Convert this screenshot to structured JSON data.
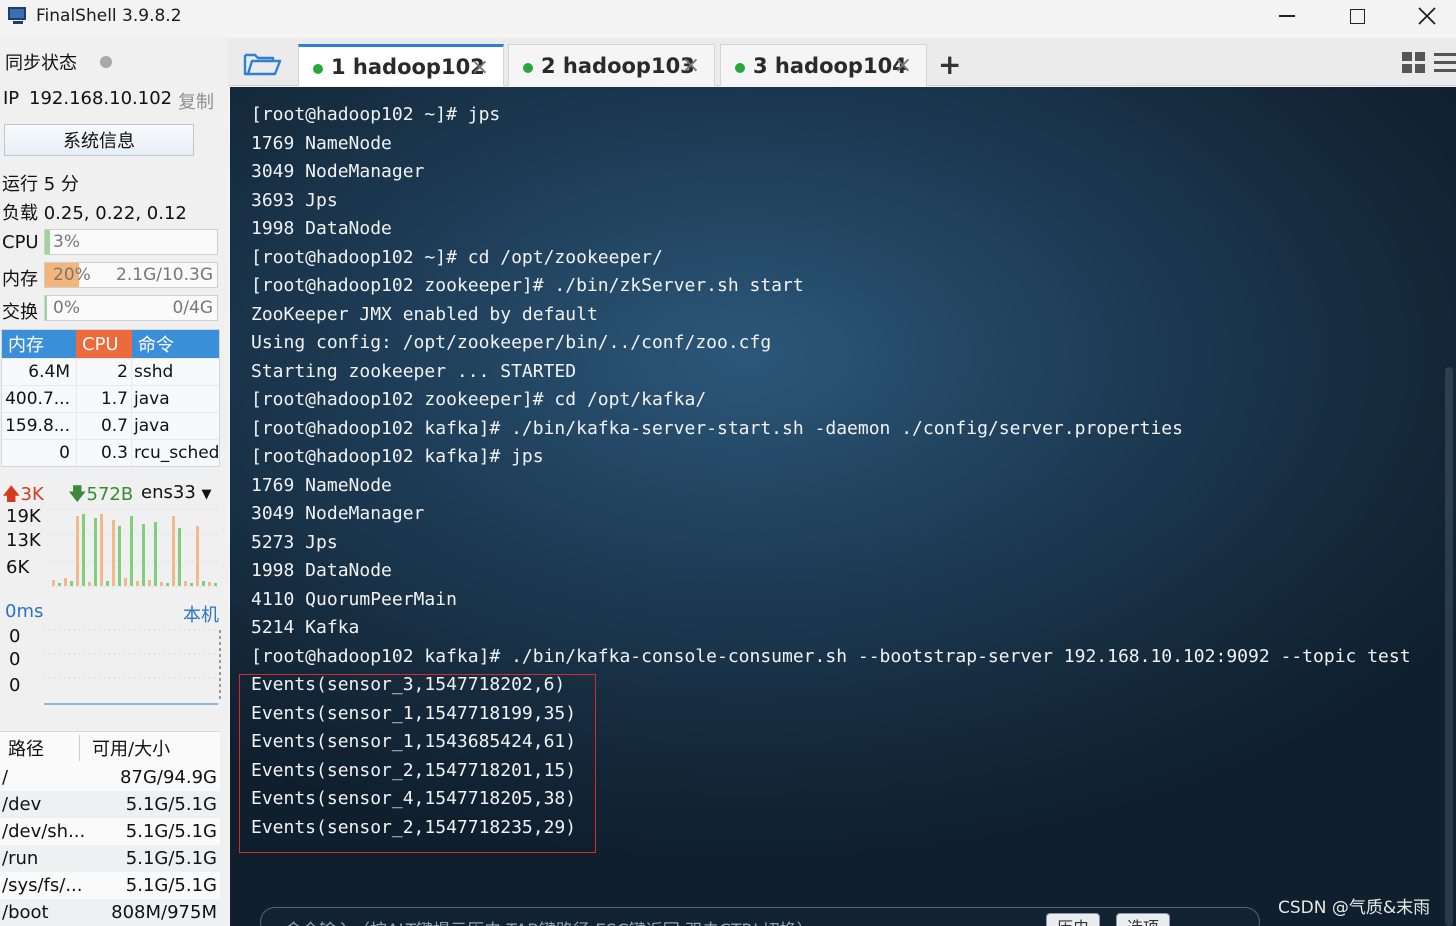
{
  "window": {
    "title": "FinalShell 3.9.8.2"
  },
  "sidebar": {
    "sync_label": "同步状态",
    "ip_label": "IP",
    "ip_value": "192.168.10.102",
    "copy_label": "复制",
    "sysinfo_button": "系统信息",
    "uptime": "运行 5 分",
    "load": "负载 0.25, 0.22, 0.12",
    "cpu": {
      "label": "CPU",
      "value": "3%",
      "fraction": 0.03
    },
    "memory": {
      "label": "内存",
      "value": "20%",
      "detail": "2.1G/10.3G",
      "fraction": 0.2
    },
    "swap": {
      "label": "交换",
      "value": "0%",
      "detail": "0/4G",
      "fraction": 0.0
    },
    "process_table": {
      "headers": [
        "内存",
        "CPU",
        "命令"
      ],
      "rows": [
        {
          "mem": "6.4M",
          "cpu": "2",
          "cmd": "sshd"
        },
        {
          "mem": "400.7...",
          "cpu": "1.7",
          "cmd": "java"
        },
        {
          "mem": "159.8...",
          "cpu": "0.7",
          "cmd": "java"
        },
        {
          "mem": "0",
          "cpu": "0.3",
          "cmd": "rcu_sched"
        }
      ]
    },
    "network": {
      "upload": "3K",
      "download": "572B",
      "interface": "ens33",
      "y_labels": [
        "19K",
        "13K",
        "6K"
      ]
    },
    "ping": {
      "latency": "0ms",
      "host": "本机",
      "values": [
        "0",
        "0",
        "0"
      ]
    },
    "disk_table": {
      "headers": [
        "路径",
        "可用/大小"
      ],
      "rows": [
        {
          "path": "/",
          "size": "87G/94.9G"
        },
        {
          "path": "/dev",
          "size": "5.1G/5.1G"
        },
        {
          "path": "/dev/sh...",
          "size": "5.1G/5.1G"
        },
        {
          "path": "/run",
          "size": "5.1G/5.1G"
        },
        {
          "path": "/sys/fs/...",
          "size": "5.1G/5.1G"
        },
        {
          "path": "/boot",
          "size": "808M/975M"
        }
      ]
    }
  },
  "tabs": [
    {
      "label": "1 hadoop102",
      "active": true
    },
    {
      "label": "2 hadoop103",
      "active": false
    },
    {
      "label": "3 hadoop104",
      "active": false
    }
  ],
  "tab_add": "+",
  "terminal": {
    "lines": [
      "[root@hadoop102 ~]# jps",
      "1769 NameNode",
      "3049 NodeManager",
      "3693 Jps",
      "1998 DataNode",
      "[root@hadoop102 ~]# cd /opt/zookeeper/",
      "[root@hadoop102 zookeeper]# ./bin/zkServer.sh start",
      "ZooKeeper JMX enabled by default",
      "Using config: /opt/zookeeper/bin/../conf/zoo.cfg",
      "Starting zookeeper ... STARTED",
      "[root@hadoop102 zookeeper]# cd /opt/kafka/",
      "[root@hadoop102 kafka]# ./bin/kafka-server-start.sh -daemon ./config/server.properties",
      "[root@hadoop102 kafka]# jps",
      "1769 NameNode",
      "3049 NodeManager",
      "5273 Jps",
      "1998 DataNode",
      "4110 QuorumPeerMain",
      "5214 Kafka",
      "[root@hadoop102 kafka]# ./bin/kafka-console-consumer.sh --bootstrap-server 192.168.10.102:9092 --topic test",
      "Events(sensor_3,1547718202,6)",
      "Events(sensor_1,1547718199,35)",
      "Events(sensor_1,1543685424,61)",
      "Events(sensor_2,1547718201,15)",
      "Events(sensor_4,1547718205,38)",
      "Events(sensor_2,1547718235,29)"
    ],
    "command_input_placeholder": "命令输入（按ALT键提示历史,TAB键路径,ESC键返回,双击CTRL切换）",
    "history_button": "历史",
    "options_button": "选项"
  },
  "watermark": "CSDN @气质&末雨",
  "colors": {
    "accent_blue": "#3b8ed8",
    "cpu_orange": "#ec6a3b",
    "memory_orange": "#f3b57a",
    "status_green": "#27a83d",
    "highlight_red": "#d8282f"
  }
}
